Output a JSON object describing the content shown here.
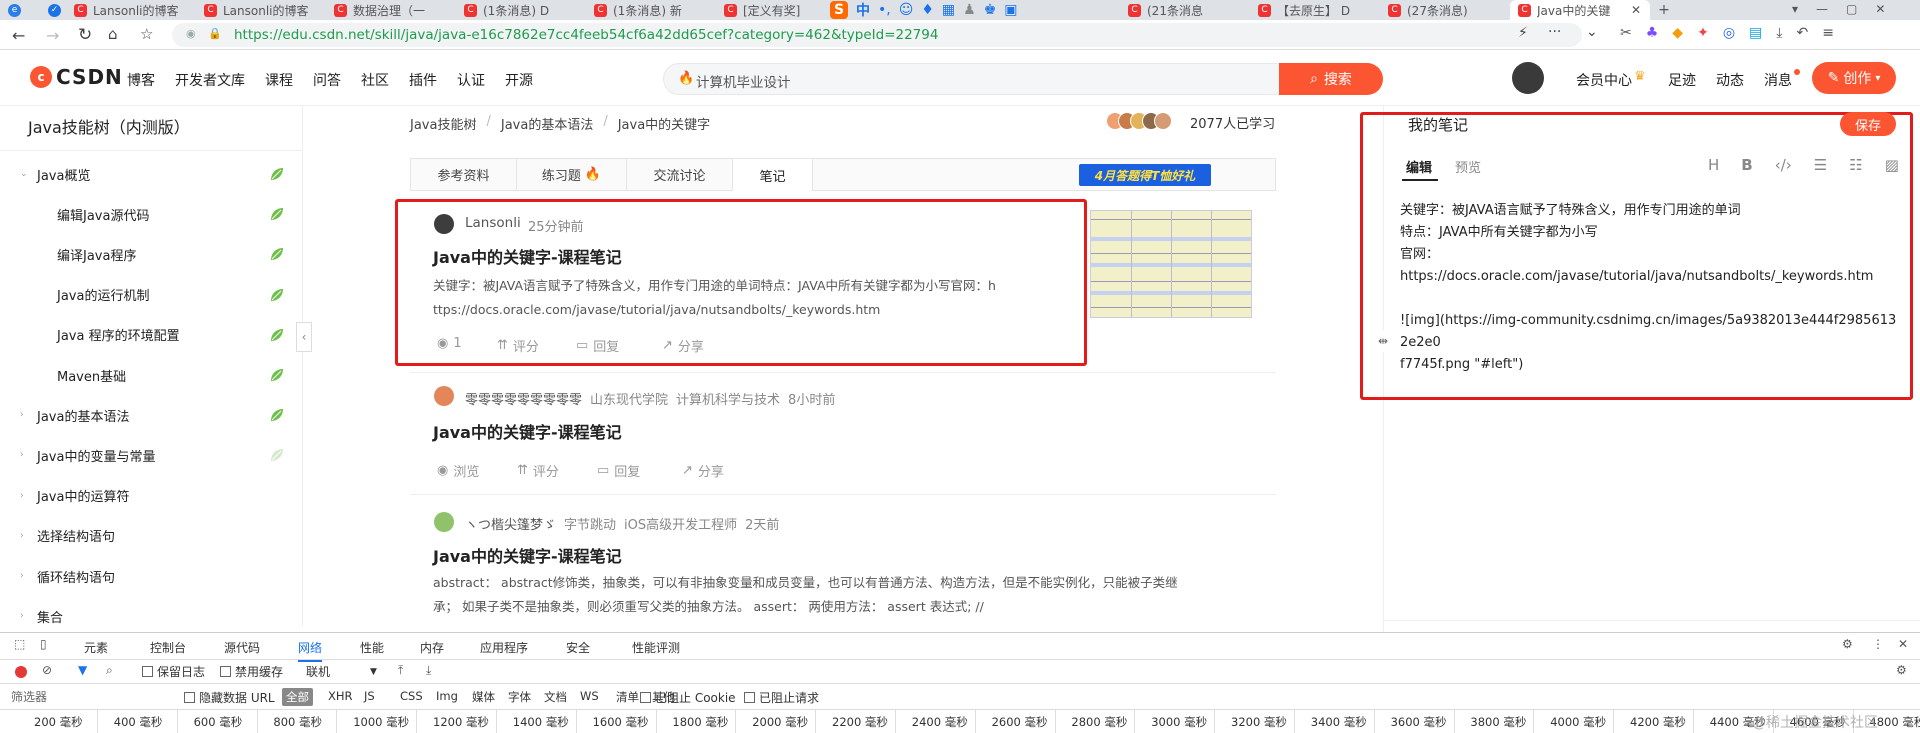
{
  "browser": {
    "tabs": [
      {
        "label": "Lansonli的博客"
      },
      {
        "label": "Lansonli的博客"
      },
      {
        "label": "数据治理（一"
      },
      {
        "label": "(1条消息) D"
      },
      {
        "label": "(1条消息) 新"
      },
      {
        "label": "[定义有奖]"
      },
      {
        "label": "(21条消息"
      },
      {
        "label": "【去原生】 D"
      },
      {
        "label": "(27条消息)"
      },
      {
        "label": "Java中的关键"
      }
    ],
    "url": "https://edu.csdn.net/skill/java/java-e16c7862e7cc4feeb54cf6a42dd65cef?category=462&typeId=22794",
    "ime_label": "中"
  },
  "header": {
    "logo": "CSDN",
    "nav": [
      "博客",
      "开发者文库",
      "课程",
      "问答",
      "社区",
      "插件",
      "认证",
      "开源"
    ],
    "search_placeholder": "计算机毕业设计",
    "search_button": "搜索",
    "right": [
      "会员中心",
      "足迹",
      "动态",
      "消息"
    ],
    "create_button": "创作"
  },
  "sidebar": {
    "title": "Java技能树（内测版）",
    "items": [
      {
        "label": "Java概览",
        "level": 0,
        "expanded": true
      },
      {
        "label": "编辑Java源代码",
        "level": 1
      },
      {
        "label": "编译Java程序",
        "level": 1
      },
      {
        "label": "Java的运行机制",
        "level": 1
      },
      {
        "label": "Java 程序的环境配置",
        "level": 1
      },
      {
        "label": "Maven基础",
        "level": 1
      },
      {
        "label": "Java的基本语法",
        "level": 0
      },
      {
        "label": "Java中的变量与常量",
        "level": 0
      },
      {
        "label": "Java中的运算符",
        "level": 0
      },
      {
        "label": "选择结构语句",
        "level": 0
      },
      {
        "label": "循环结构语句",
        "level": 0
      },
      {
        "label": "集合",
        "level": 0
      }
    ]
  },
  "breadcrumb": [
    "Java技能树",
    "Java的基本语法",
    "Java中的关键字"
  ],
  "learners": "2077人已学习",
  "content_tabs": [
    "参考资料",
    "练习题",
    "交流讨论",
    "笔记"
  ],
  "banner": "4月答题得T恤好礼",
  "notes": [
    {
      "author": "Lansonli",
      "time": "25分钟前",
      "title": "Java中的关键字-课程笔记",
      "excerpt_line1": "关键字：被JAVA语言赋予了特殊含义，用作专门用途的单词特点：JAVA中所有关键字都为小写官网：h",
      "excerpt_line2": "ttps://docs.oracle.com/javase/tutorial/java/nutsandbolts/_keywords.htm",
      "views": "1",
      "rate": "评分",
      "reply": "回复",
      "share": "分享"
    },
    {
      "author": "零零零零零零零零零",
      "school": "山东现代学院",
      "major": "计算机科学与技术",
      "time": "8小时前",
      "title": "Java中的关键字-课程笔记",
      "views": "浏览",
      "rate": "评分",
      "reply": "回复",
      "share": "分享"
    },
    {
      "author": "ヽつ楷尖篷梦ゞ",
      "school": "字节跳动",
      "major": "iOS高级开发工程师",
      "time": "2天前",
      "title": "Java中的关键字-课程笔记",
      "excerpt_line1": "abstract： abstract修饰类，抽象类，可以有非抽象变量和成员变量，也可以有普通方法、构造方法，但是不能实例化，只能被子类继",
      "excerpt_line2": "承；  如果子类不是抽象类，则必须重写父类的抽象方法。 assert： 两使用方法：  assert 表达式; //"
    }
  ],
  "my_notes": {
    "title": "我的笔记",
    "save": "保存",
    "tab_edit": "编辑",
    "tab_preview": "预览",
    "lines": [
      "关键字：被JAVA语言赋予了特殊含义，用作专门用途的单词",
      "特点：JAVA中所有关键字都为小写",
      "官网：https://docs.oracle.com/javase/tutorial/java/nutsandbolts/_keywords.htm",
      "![img](https://img-community.csdnimg.cn/images/5a9382013e444f29856132e2e0",
      "f7745f.png \"#left\")"
    ]
  },
  "devtools": {
    "tabs": [
      "元素",
      "控制台",
      "源代码",
      "网络",
      "性能",
      "内存",
      "应用程序",
      "安全",
      "性能评测"
    ],
    "preserve_log": "保留日志",
    "disable_cache": "禁用缓存",
    "throttle": "联机",
    "filter_placeholder": "筛选器",
    "hide_data_url": "隐藏数据 URL",
    "types": [
      "全部",
      "XHR",
      "JS",
      "CSS",
      "Img",
      "媒体",
      "字体",
      "文档",
      "WS",
      "清单",
      "其他"
    ],
    "block_cookie": "已阻止 Cookie",
    "block_request": "已阻止请求",
    "timeline": [
      "200 毫秒",
      "400 毫秒",
      "600 毫秒",
      "800 毫秒",
      "1000 毫秒",
      "1200 毫秒",
      "1400 毫秒",
      "1600 毫秒",
      "1800 毫秒",
      "2000 毫秒",
      "2200 毫秒",
      "2400 毫秒",
      "2600 毫秒",
      "2800 毫秒",
      "3000 毫秒",
      "3200 毫秒",
      "3400 毫秒",
      "3600 毫秒",
      "3800 毫秒",
      "4000 毫秒",
      "4200 毫秒",
      "4400 毫秒",
      "4600 毫秒",
      "4800 毫秒"
    ]
  },
  "watermark": "@稀土掘金技术社区",
  "colors": {
    "accent": "#fc5531",
    "highlight": "#e31b1b",
    "leaf": "#6cc04a"
  }
}
